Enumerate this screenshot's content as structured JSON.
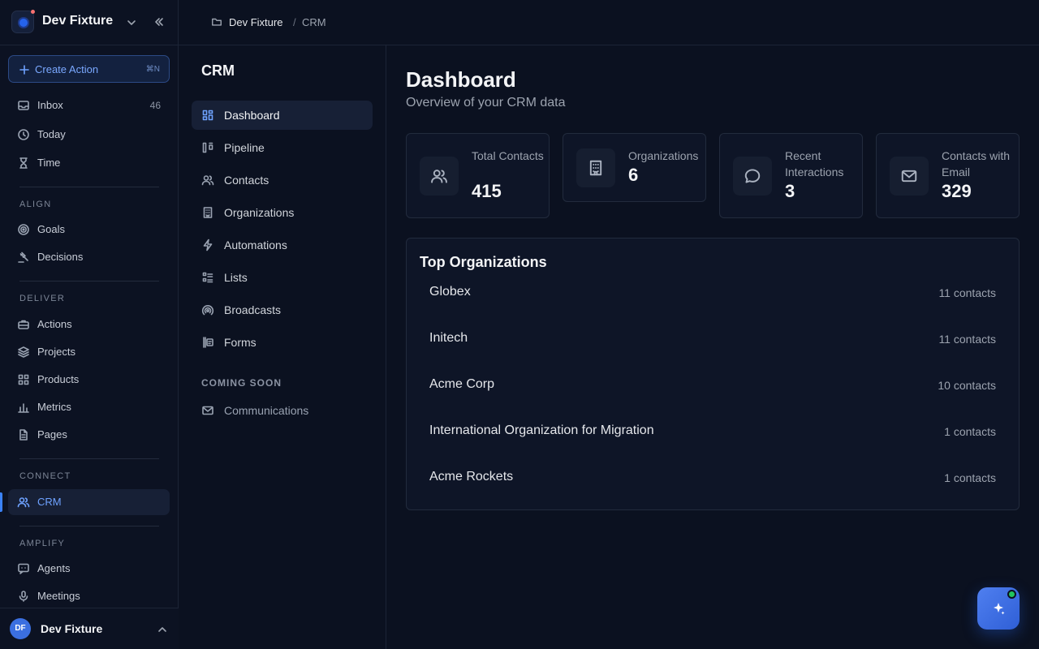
{
  "workspace": {
    "name": "Dev Fixture"
  },
  "create_action": {
    "label": "Create Action",
    "shortcut": "⌘N"
  },
  "sidebar": {
    "top_items": [
      {
        "label": "Inbox",
        "count": "46",
        "icon": "inbox-icon"
      },
      {
        "label": "Today",
        "icon": "clock-icon"
      },
      {
        "label": "Time",
        "icon": "hourglass-icon"
      }
    ],
    "sections": {
      "align": {
        "label": "ALIGN",
        "items": [
          {
            "label": "Goals",
            "icon": "target-icon"
          },
          {
            "label": "Decisions",
            "icon": "gavel-icon"
          }
        ]
      },
      "deliver": {
        "label": "DELIVER",
        "items": [
          {
            "label": "Actions",
            "icon": "briefcase-icon"
          },
          {
            "label": "Projects",
            "icon": "layers-icon"
          },
          {
            "label": "Products",
            "icon": "grid-icon"
          },
          {
            "label": "Metrics",
            "icon": "bar-chart-icon"
          },
          {
            "label": "Pages",
            "icon": "file-icon"
          }
        ]
      },
      "connect": {
        "label": "CONNECT",
        "items": [
          {
            "label": "CRM",
            "icon": "users-icon",
            "active": true
          }
        ]
      },
      "amplify": {
        "label": "AMPLIFY",
        "items": [
          {
            "label": "Agents",
            "icon": "chat-bot-icon"
          },
          {
            "label": "Meetings",
            "icon": "microphone-icon"
          }
        ]
      }
    }
  },
  "user": {
    "initials": "DF",
    "name": "Dev Fixture"
  },
  "breadcrumb": {
    "root": "Dev Fixture",
    "separator": "/",
    "current": "CRM"
  },
  "crm_nav": {
    "title": "CRM",
    "items": [
      {
        "label": "Dashboard",
        "icon": "dashboard-icon",
        "active": true
      },
      {
        "label": "Pipeline",
        "icon": "kanban-icon"
      },
      {
        "label": "Contacts",
        "icon": "users-icon"
      },
      {
        "label": "Organizations",
        "icon": "building-icon"
      },
      {
        "label": "Automations",
        "icon": "bolt-icon"
      },
      {
        "label": "Lists",
        "icon": "list-icon"
      },
      {
        "label": "Broadcasts",
        "icon": "broadcast-icon"
      },
      {
        "label": "Forms",
        "icon": "form-icon"
      }
    ],
    "coming_soon_label": "COMING SOON",
    "coming_soon_items": [
      {
        "label": "Communications",
        "icon": "mail-icon"
      }
    ]
  },
  "dashboard": {
    "title": "Dashboard",
    "subtitle": "Overview of your CRM data",
    "stats": [
      {
        "label": "Total Contacts",
        "value": "415",
        "icon": "users-icon"
      },
      {
        "label": "Organizations",
        "value": "6",
        "icon": "building-icon"
      },
      {
        "label": "Recent Interactions",
        "value": "3",
        "icon": "chat-bubble-icon"
      },
      {
        "label": "Contacts with Email",
        "value": "329",
        "icon": "mail-icon"
      }
    ],
    "top_organizations": {
      "title": "Top Organizations",
      "rows": [
        {
          "name": "Globex",
          "count": "11 contacts"
        },
        {
          "name": "Initech",
          "count": "11 contacts"
        },
        {
          "name": "Acme Corp",
          "count": "10 contacts"
        },
        {
          "name": "International Organization for Migration",
          "count": "1 contacts"
        },
        {
          "name": "Acme Rockets",
          "count": "1 contacts"
        }
      ]
    }
  },
  "colors": {
    "accent": "#3b82f6",
    "background": "#0b1120",
    "online": "#22c55e"
  }
}
